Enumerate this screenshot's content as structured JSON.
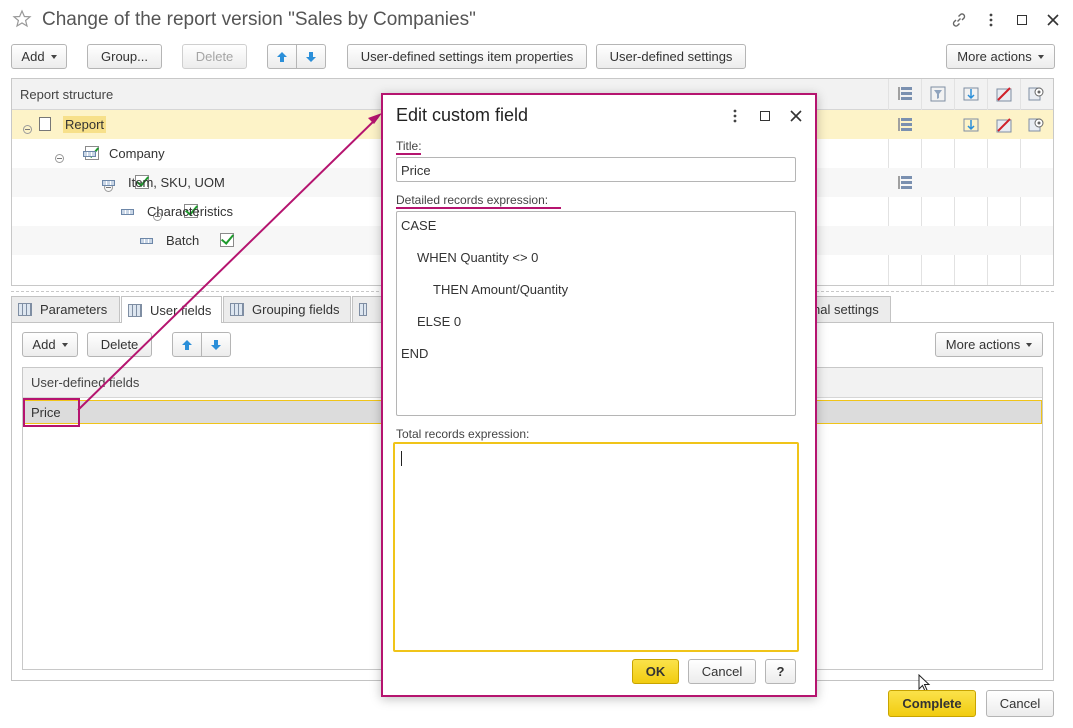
{
  "window": {
    "title": "Change of the report version \"Sales by Companies\"",
    "icons": [
      "star-icon",
      "link-icon",
      "more-vert-icon",
      "maximize-icon",
      "close-icon"
    ]
  },
  "toolbar": {
    "add_label": "Add",
    "group_label": "Group...",
    "delete_label": "Delete",
    "item_props_label": "User-defined settings item properties",
    "user_settings_label": "User-defined settings",
    "more_actions_label": "More actions"
  },
  "structure": {
    "header": "Report structure",
    "rows": [
      {
        "label": "Report"
      },
      {
        "label": "Company"
      },
      {
        "label": "Item, SKU, UOM"
      },
      {
        "label": "Characteristics"
      },
      {
        "label": "Batch"
      }
    ]
  },
  "tabs": [
    {
      "label": "Parameters"
    },
    {
      "label": "User fields"
    },
    {
      "label": "Grouping fields"
    },
    {
      "label": "nal settings"
    }
  ],
  "fields_toolbar": {
    "add_label": "Add",
    "delete_label": "Delete",
    "more_actions_label": "More actions"
  },
  "fields_list": {
    "header": "User-defined fields",
    "rows": [
      {
        "label": "Price"
      }
    ]
  },
  "dialog": {
    "title": "Edit custom field",
    "title_label": "Title:",
    "title_value": "Price",
    "detailed_label": "Detailed records expression:",
    "detailed_lines": [
      "CASE",
      "WHEN Quantity <> 0",
      "THEN Amount/Quantity",
      "ELSE 0",
      "END"
    ],
    "total_label": "Total records expression:",
    "ok_label": "OK",
    "cancel_label": "Cancel",
    "help_label": "?"
  },
  "footer": {
    "complete_label": "Complete",
    "cancel_label": "Cancel"
  },
  "colors": {
    "highlight": "#b5146f",
    "selected_row": "#fdf3c8",
    "primary_button": "#f3d21c"
  }
}
